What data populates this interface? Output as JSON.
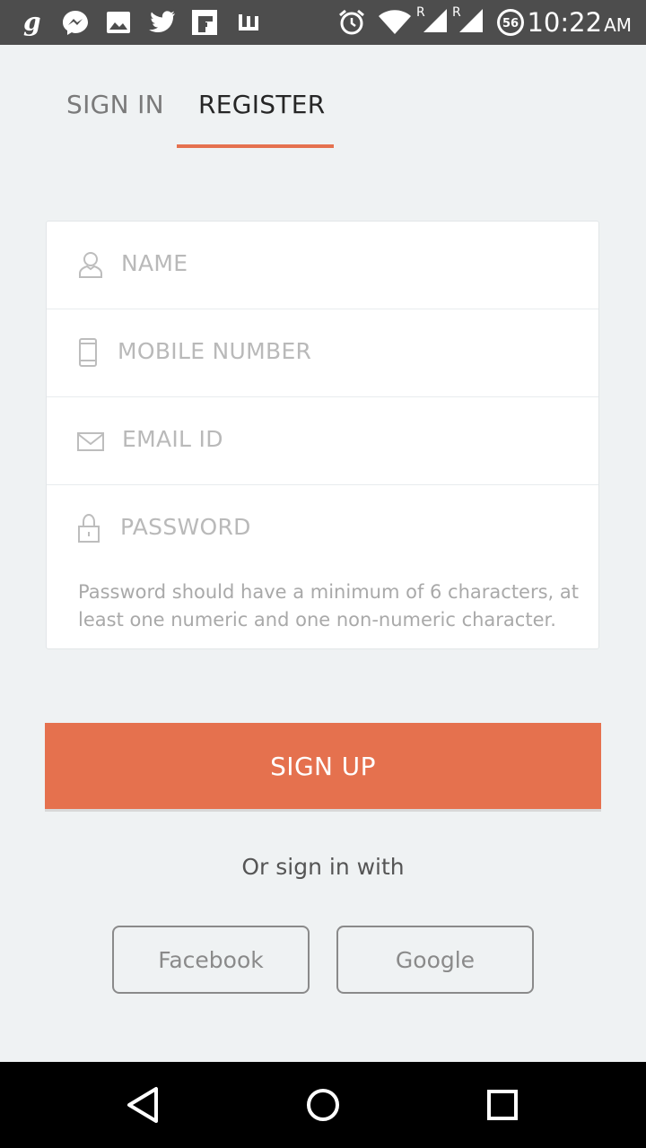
{
  "status_bar": {
    "time": "10:22",
    "ampm": "AM",
    "notification_icons": [
      "gaana-icon",
      "messenger-icon",
      "gallery-icon",
      "twitter-icon",
      "flipboard-icon",
      "wish-icon"
    ],
    "system_icons": [
      "alarm-icon",
      "wifi-icon",
      "signal-icon",
      "signal-icon",
      "battery-icon"
    ],
    "roaming_label": "R",
    "battery_level": "56"
  },
  "tabs": [
    {
      "label": "SIGN IN",
      "active": false
    },
    {
      "label": "REGISTER",
      "active": true
    }
  ],
  "form": {
    "name_placeholder": "NAME",
    "mobile_placeholder": "MOBILE NUMBER",
    "email_placeholder": "EMAIL ID",
    "password_placeholder": "PASSWORD",
    "password_hint": "Password should have a minimum of 6 characters, at least one numeric and one non-numeric character."
  },
  "signup_label": "SIGN UP",
  "or_sign_in_with": "Or sign in with",
  "social": {
    "facebook_label": "Facebook",
    "google_label": "Google"
  },
  "colors": {
    "accent": "#e5714e",
    "status_bar": "#4d4d4d",
    "background": "#eff2f3"
  },
  "nav_bar": {
    "icons": [
      "back-icon",
      "home-icon",
      "recents-icon"
    ]
  }
}
